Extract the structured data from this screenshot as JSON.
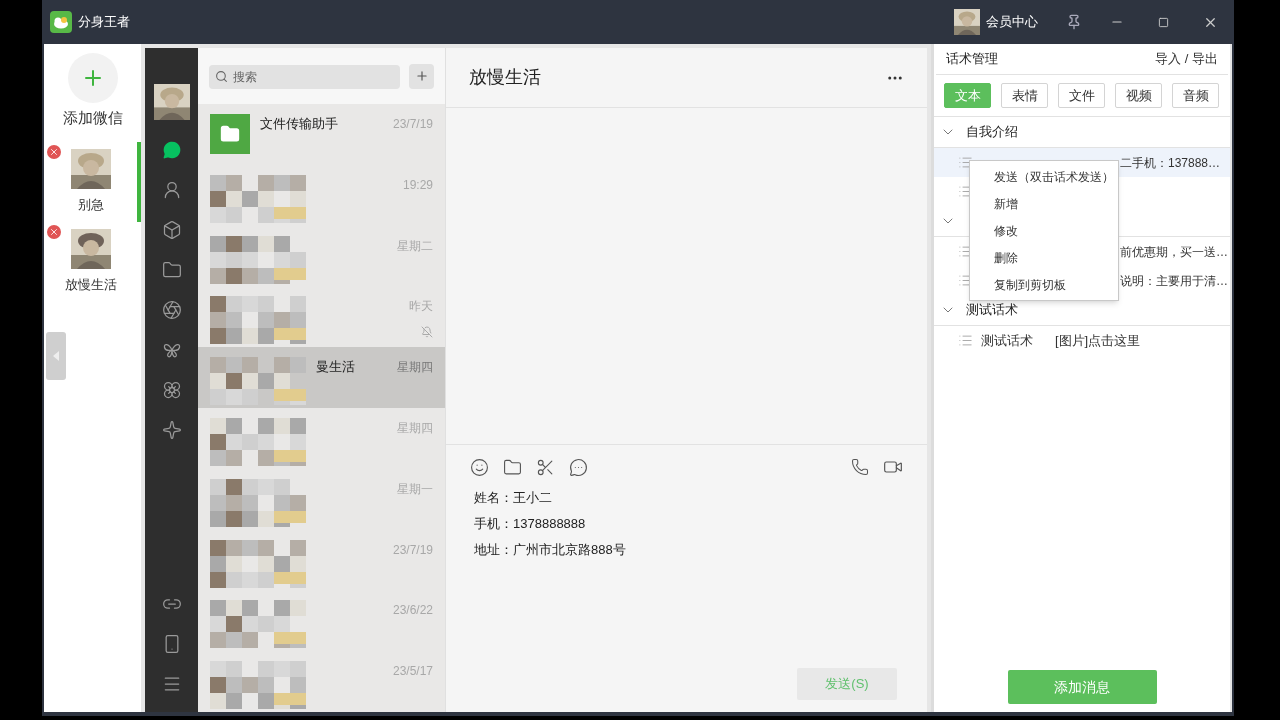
{
  "window": {
    "title": "分身王者",
    "member_center": "会员中心"
  },
  "accounts": {
    "add_label": "添加微信",
    "items": [
      {
        "name": "别急",
        "selected": true
      },
      {
        "name": "放慢生活",
        "selected": false
      }
    ]
  },
  "nav": {
    "top": [
      {
        "kind": "chat",
        "selected": true
      },
      {
        "kind": "contacts",
        "selected": false
      },
      {
        "kind": "cube",
        "selected": false
      },
      {
        "kind": "folder",
        "selected": false
      },
      {
        "kind": "aperture",
        "selected": false
      },
      {
        "kind": "butterfly",
        "selected": false
      },
      {
        "kind": "flower",
        "selected": false
      },
      {
        "kind": "sparkle",
        "selected": false
      }
    ],
    "bottom": [
      {
        "kind": "link",
        "selected": false
      },
      {
        "kind": "phone",
        "selected": false
      },
      {
        "kind": "menu",
        "selected": false
      }
    ]
  },
  "chat_list": {
    "search_placeholder": "搜索",
    "items": [
      {
        "kind": "file",
        "name": "文件传输助手",
        "time": "23/7/19",
        "selected": false,
        "muted": false
      },
      {
        "kind": "blurred",
        "time": "19:29",
        "selected": false,
        "muted": false
      },
      {
        "kind": "blurred",
        "time": "星期二",
        "selected": false,
        "muted": false
      },
      {
        "kind": "blurred",
        "time": "昨天",
        "selected": false,
        "muted": true
      },
      {
        "kind": "blurred",
        "name": "曼生活",
        "time": "星期四",
        "selected": true,
        "muted": false
      },
      {
        "kind": "blurred",
        "time": "星期四",
        "selected": false,
        "muted": false
      },
      {
        "kind": "blurred",
        "time": "星期一",
        "selected": false,
        "muted": false
      },
      {
        "kind": "blurred",
        "time": "23/7/19",
        "selected": false,
        "muted": false
      },
      {
        "kind": "blurred",
        "time": "23/6/22",
        "selected": false,
        "muted": false
      },
      {
        "kind": "blurred",
        "time": "23/5/17",
        "selected": false,
        "muted": false
      }
    ]
  },
  "chat": {
    "title": "放慢生活",
    "draft_lines": [
      "姓名：王小二",
      "手机：1378888888",
      "地址：广州市北京路888号"
    ],
    "send_label": "发送(S)"
  },
  "scripts": {
    "title": "话术管理",
    "import_export": "导入 / 导出",
    "tabs": [
      {
        "label": "文本",
        "selected": true
      },
      {
        "label": "表情",
        "selected": false
      },
      {
        "label": "文件",
        "selected": false
      },
      {
        "label": "视频",
        "selected": false
      },
      {
        "label": "音频",
        "selected": false
      }
    ],
    "groups": [
      {
        "name": "自我介绍",
        "expanded": true,
        "items": [
          {
            "text": "二手机：137888…",
            "selected": true
          },
          {
            "selected": false
          }
        ]
      },
      {
        "expanded": true,
        "items": [
          {
            "text": "前优惠期，买一送…",
            "selected": false
          },
          {
            "text": "说明：主要用于清…",
            "selected": false
          }
        ]
      },
      {
        "name": "测试话术",
        "expanded": true,
        "items": [
          {
            "title": "测试话术",
            "text": "[图片]点击这里",
            "selected": false
          }
        ]
      }
    ],
    "context_menu": [
      "发送（双击话术发送）",
      "新增",
      "修改",
      "删除",
      "复制到剪切板"
    ],
    "add_label": "添加消息"
  }
}
